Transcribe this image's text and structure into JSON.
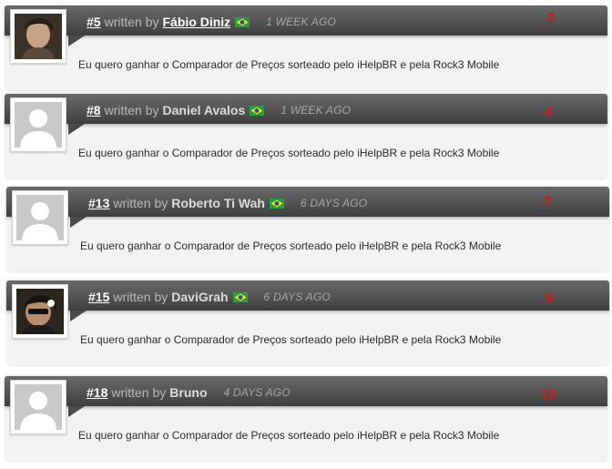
{
  "comments": [
    {
      "number": "#5",
      "written_by": "written by",
      "author": "Fábio Diniz",
      "flag": "brazil-flag-icon",
      "time": "1 WEEK AGO",
      "votes": "2",
      "avatar": "user-photo",
      "text": "Eu quero ganhar o Comparador de Preços sorteado pelo iHelpBR e pela Rock3 Mobile"
    },
    {
      "number": "#8",
      "written_by": "written by",
      "author": "Daniel Avalos",
      "flag": "brazil-flag-icon",
      "time": "1 WEEK AGO",
      "votes": "4",
      "avatar": "default-avatar",
      "text": "Eu quero ganhar o Comparador de Preços sorteado pelo iHelpBR e pela Rock3 Mobile"
    },
    {
      "number": "#13",
      "written_by": "written by",
      "author": "Roberto Ti Wah",
      "flag": "brazil-flag-icon",
      "time": "6 DAYS AGO",
      "votes": "7",
      "avatar": "default-avatar",
      "text": "Eu quero ganhar o Comparador de Preços sorteado pelo iHelpBR e pela Rock3 Mobile"
    },
    {
      "number": "#15",
      "written_by": "written by",
      "author": "DaviGrah",
      "flag": "brazil-flag-icon",
      "time": "6 DAYS AGO",
      "votes": "9",
      "avatar": "user-photo",
      "text": "Eu quero ganhar o Comparador de Preços sorteado pelo iHelpBR e pela Rock3 Mobile"
    },
    {
      "number": "#18",
      "written_by": "written by",
      "author": "Bruno",
      "flag": "",
      "time": "4 DAYS AGO",
      "votes": "12",
      "avatar": "default-avatar",
      "text": "Eu quero ganhar o Comparador de Preços sorteado pelo iHelpBR e pela Rock3 Mobile"
    }
  ],
  "colors": {
    "header_bar": "#555555",
    "vote_number": "#dd1515",
    "card_bg": "#f3f3f3"
  }
}
